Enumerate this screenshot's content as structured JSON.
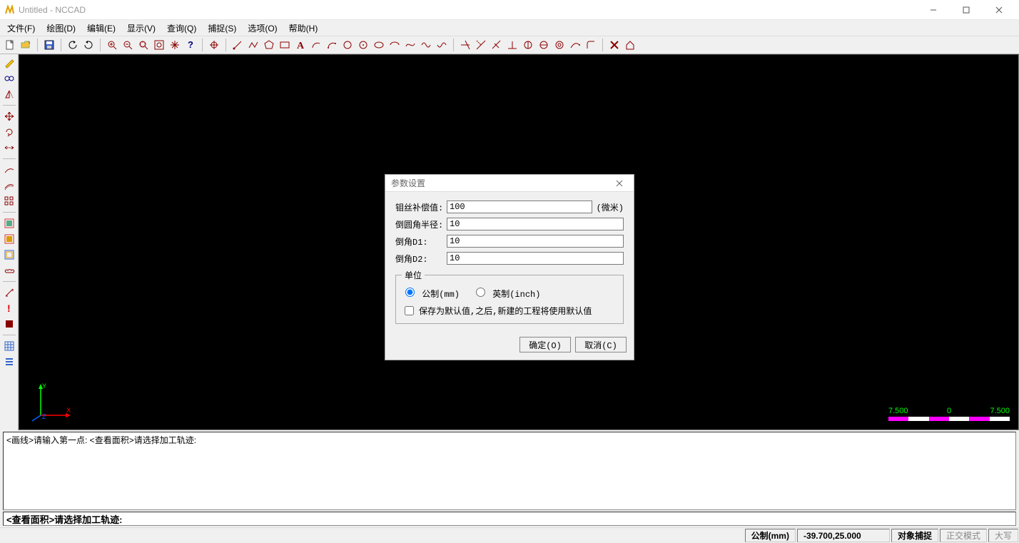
{
  "title": "Untitled - NCCAD",
  "menu": [
    "文件(F)",
    "绘图(D)",
    "编辑(E)",
    "显示(V)",
    "查询(Q)",
    "捕捉(S)",
    "选项(O)",
    "帮助(H)"
  ],
  "ruler": {
    "left": "7.500",
    "mid": "0",
    "right": "7.500"
  },
  "cmd_history": "<画线>请输入第一点: <查看面积>请选择加工轨迹:",
  "cmd_prompt": "<查看面积>请选择加工轨迹:",
  "status": {
    "unit": "公制(mm)",
    "coords": "-39.700,25.000",
    "snap": "对象捕捉",
    "ortho": "正交模式",
    "caps": "大写"
  },
  "dialog": {
    "title": "参数设置",
    "fields": {
      "offset_label": "钼丝补偿值:",
      "offset_value": "100",
      "offset_suffix": "(微米)",
      "fillet_label": "倒圆角半径:",
      "fillet_value": "10",
      "d1_label": "倒角D1:",
      "d1_value": "10",
      "d2_label": "倒角D2:",
      "d2_value": "10"
    },
    "unit_group": {
      "legend": "单位",
      "metric": "公制(mm)",
      "imperial": "英制(inch)",
      "save_default": "保存为默认值,之后,新建的工程将使用默认值"
    },
    "buttons": {
      "ok": "确定(O)",
      "cancel": "取消(C)"
    }
  }
}
